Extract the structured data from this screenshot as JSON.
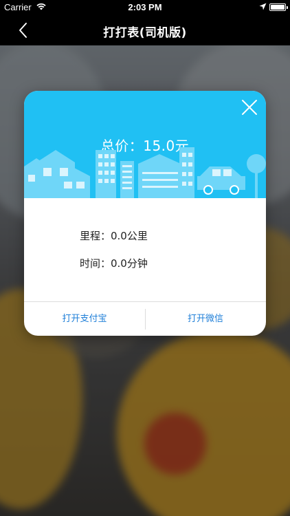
{
  "status_bar": {
    "carrier": "Carrier",
    "time": "2:03 PM",
    "icons": [
      "wifi-icon",
      "location-arrow-icon",
      "battery-icon"
    ]
  },
  "nav": {
    "back_icon": "chevron-left-icon",
    "title": "打打表(司机版)"
  },
  "dialog": {
    "close_icon": "close-icon",
    "total_price": "总价：15.0元",
    "mileage": "里程：0.0公里",
    "duration": "时间：0.0分钟",
    "buttons": {
      "alipay": "打开支付宝",
      "wechat": "打开微信"
    }
  },
  "colors": {
    "header_blue": "#20c0f3",
    "link_blue": "#1f7fd8",
    "nav_background": "#000000"
  }
}
